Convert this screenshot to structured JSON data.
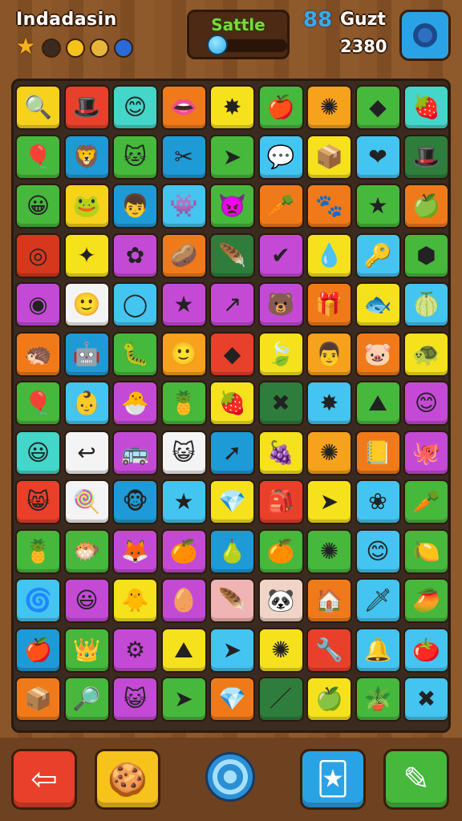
{
  "header": {
    "title": "Indadasin",
    "center_title": "Sattle",
    "player_name": "Guzt",
    "score": "2380",
    "progress": 0.0,
    "icons": [
      "star-icon",
      "lock-icon",
      "coin-icon",
      "coin-icon",
      "gem-icon"
    ],
    "player_icon": "88"
  },
  "colors": {
    "wood": "#7a4a22",
    "board": "#3a2a1f",
    "accent_green": "#7fd63a",
    "accent_blue": "#2aa3e6"
  },
  "board": {
    "rows": [
      [
        {
          "c": "#f6d21c",
          "g": "🔍",
          "n": "magnifier"
        },
        {
          "c": "#e8402a",
          "g": "🎩",
          "n": "hat"
        },
        {
          "c": "#44d6c8",
          "g": "😊",
          "n": "face"
        },
        {
          "c": "#f07a1a",
          "g": "👄",
          "n": "mouth"
        },
        {
          "c": "#f6e21c",
          "g": "✸",
          "n": "burst"
        },
        {
          "c": "#46b83c",
          "g": "🍎",
          "n": "apple"
        },
        {
          "c": "#f7a21c",
          "g": "✺",
          "n": "flower"
        },
        {
          "c": "#46b83c",
          "g": "◆",
          "n": "gem"
        },
        {
          "c": "#44d6c8",
          "g": "🍓",
          "n": "berry"
        }
      ],
      [
        {
          "c": "#46b83c",
          "g": "🎈",
          "n": "balloon"
        },
        {
          "c": "#1e9ad6",
          "g": "🦁",
          "n": "lion"
        },
        {
          "c": "#46b83c",
          "g": "🐱",
          "n": "cat"
        },
        {
          "c": "#1e9ad6",
          "g": "✂",
          "n": "scissors"
        },
        {
          "c": "#46b83c",
          "g": "➤",
          "n": "arrow"
        },
        {
          "c": "#44c4f0",
          "g": "💬",
          "n": "bubble"
        },
        {
          "c": "#f6e21c",
          "g": "📦",
          "n": "box"
        },
        {
          "c": "#44c4f0",
          "g": "❤",
          "n": "heart"
        },
        {
          "c": "#2e7d3c",
          "g": "🎩",
          "n": "hat"
        }
      ],
      [
        {
          "c": "#46b83c",
          "g": "😀",
          "n": "face"
        },
        {
          "c": "#f6d21c",
          "g": "🐸",
          "n": "frog"
        },
        {
          "c": "#1e9ad6",
          "g": "👦",
          "n": "boy"
        },
        {
          "c": "#44c4f0",
          "g": "👾",
          "n": "monster"
        },
        {
          "c": "#46b83c",
          "g": "👿",
          "n": "devil"
        },
        {
          "c": "#f07a1a",
          "g": "🥕",
          "n": "radish"
        },
        {
          "c": "#f07a1a",
          "g": "🐾",
          "n": "paw"
        },
        {
          "c": "#46b83c",
          "g": "★",
          "n": "star"
        },
        {
          "c": "#f07a1a",
          "g": "🍏",
          "n": "apple"
        }
      ],
      [
        {
          "c": "#d6381e",
          "g": "◎",
          "n": "ring"
        },
        {
          "c": "#f6e21c",
          "g": "✦",
          "n": "spark"
        },
        {
          "c": "#c44ad6",
          "g": "✿",
          "n": "blob"
        },
        {
          "c": "#f07a1a",
          "g": "🥔",
          "n": "potato"
        },
        {
          "c": "#2e7d3c",
          "g": "🪶",
          "n": "feather"
        },
        {
          "c": "#c44ad6",
          "g": "✔",
          "n": "check"
        },
        {
          "c": "#f6e21c",
          "g": "💧",
          "n": "drop"
        },
        {
          "c": "#44c4f0",
          "g": "🔑",
          "n": "key"
        },
        {
          "c": "#46b83c",
          "g": "⬢",
          "n": "hexagon"
        }
      ],
      [
        {
          "c": "#c44ad6",
          "g": "◉",
          "n": "donut"
        },
        {
          "c": "#f4f4f4",
          "g": "🙂",
          "n": "face"
        },
        {
          "c": "#44c4f0",
          "g": "◯",
          "n": "ring"
        },
        {
          "c": "#c44ad6",
          "g": "★",
          "n": "star"
        },
        {
          "c": "#c44ad6",
          "g": "↗",
          "n": "arrow"
        },
        {
          "c": "#c44ad6",
          "g": "🐻",
          "n": "bear"
        },
        {
          "c": "#f07a1a",
          "g": "🎁",
          "n": "gift"
        },
        {
          "c": "#f6e21c",
          "g": "🐟",
          "n": "fish"
        },
        {
          "c": "#44c4f0",
          "g": "🍈",
          "n": "melon"
        }
      ],
      [
        {
          "c": "#f07a1a",
          "g": "🦔",
          "n": "hedgehog"
        },
        {
          "c": "#1e9ad6",
          "g": "🤖",
          "n": "robot"
        },
        {
          "c": "#46b83c",
          "g": "🐛",
          "n": "bug"
        },
        {
          "c": "#f6a21c",
          "g": "🙂",
          "n": "face"
        },
        {
          "c": "#e8402a",
          "g": "◆",
          "n": "diamond"
        },
        {
          "c": "#f6e21c",
          "g": "🍃",
          "n": "leaf"
        },
        {
          "c": "#f6a21c",
          "g": "👨",
          "n": "man"
        },
        {
          "c": "#f07a1a",
          "g": "🐷",
          "n": "pig"
        },
        {
          "c": "#f6e21c",
          "g": "🐢",
          "n": "turtle"
        }
      ],
      [
        {
          "c": "#46b83c",
          "g": "🎈",
          "n": "balloon"
        },
        {
          "c": "#44c4f0",
          "g": "👶",
          "n": "baby"
        },
        {
          "c": "#c44ad6",
          "g": "🐣",
          "n": "chick"
        },
        {
          "c": "#46b83c",
          "g": "🍍",
          "n": "pineapple"
        },
        {
          "c": "#f6e21c",
          "g": "🍓",
          "n": "strawberry"
        },
        {
          "c": "#2e7d3c",
          "g": "✖",
          "n": "cross"
        },
        {
          "c": "#44c4f0",
          "g": "✸",
          "n": "burst"
        },
        {
          "c": "#46b83c",
          "g": "⛰",
          "n": "mountain"
        },
        {
          "c": "#c44ad6",
          "g": "😊",
          "n": "face"
        }
      ],
      [
        {
          "c": "#44d6c8",
          "g": "😃",
          "n": "face"
        },
        {
          "c": "#f4f4f4",
          "g": "↩",
          "n": "return"
        },
        {
          "c": "#c44ad6",
          "g": "🚌",
          "n": "bus"
        },
        {
          "c": "#f4f4f4",
          "g": "😺",
          "n": "cat"
        },
        {
          "c": "#1e9ad6",
          "g": "➚",
          "n": "arrow"
        },
        {
          "c": "#f6e21c",
          "g": "🍇",
          "n": "grape"
        },
        {
          "c": "#f6a21c",
          "g": "✺",
          "n": "splat"
        },
        {
          "c": "#f07a1a",
          "g": "📒",
          "n": "book"
        },
        {
          "c": "#c44ad6",
          "g": "🐙",
          "n": "octopus"
        }
      ],
      [
        {
          "c": "#e8402a",
          "g": "😸",
          "n": "cat"
        },
        {
          "c": "#f4f4f4",
          "g": "🍭",
          "n": "lollipop"
        },
        {
          "c": "#1e9ad6",
          "g": "🐵",
          "n": "monkey"
        },
        {
          "c": "#44c4f0",
          "g": "★",
          "n": "star"
        },
        {
          "c": "#f6e21c",
          "g": "💎",
          "n": "gem"
        },
        {
          "c": "#e8402a",
          "g": "🎒",
          "n": "bag"
        },
        {
          "c": "#f6e21c",
          "g": "➤",
          "n": "arrow"
        },
        {
          "c": "#44c4f0",
          "g": "❀",
          "n": "flower"
        },
        {
          "c": "#46b83c",
          "g": "🥕",
          "n": "carrot"
        }
      ],
      [
        {
          "c": "#46b83c",
          "g": "🍍",
          "n": "pineapple"
        },
        {
          "c": "#46b83c",
          "g": "🐡",
          "n": "fish"
        },
        {
          "c": "#c44ad6",
          "g": "🦊",
          "n": "fox"
        },
        {
          "c": "#c44ad6",
          "g": "🍊",
          "n": "orange"
        },
        {
          "c": "#1e9ad6",
          "g": "🍐",
          "n": "pear"
        },
        {
          "c": "#46b83c",
          "g": "🍊",
          "n": "orange"
        },
        {
          "c": "#46b83c",
          "g": "✺",
          "n": "splat"
        },
        {
          "c": "#44c4f0",
          "g": "😊",
          "n": "face"
        },
        {
          "c": "#46b83c",
          "g": "🍋",
          "n": "lemon"
        }
      ],
      [
        {
          "c": "#44c4f0",
          "g": "🌀",
          "n": "swirl"
        },
        {
          "c": "#c44ad6",
          "g": "😃",
          "n": "face"
        },
        {
          "c": "#f6e21c",
          "g": "🐥",
          "n": "chick"
        },
        {
          "c": "#c44ad6",
          "g": "🥚",
          "n": "egg"
        },
        {
          "c": "#f0b4b4",
          "g": "🪶",
          "n": "feather"
        },
        {
          "c": "#f0d4c8",
          "g": "🐼",
          "n": "panda"
        },
        {
          "c": "#f07a1a",
          "g": "🏠",
          "n": "house"
        },
        {
          "c": "#44c4f0",
          "g": "🗡",
          "n": "sword"
        },
        {
          "c": "#46b83c",
          "g": "🥭",
          "n": "mango"
        }
      ],
      [
        {
          "c": "#1e9ad6",
          "g": "🍎",
          "n": "apple"
        },
        {
          "c": "#46b83c",
          "g": "👑",
          "n": "crown"
        },
        {
          "c": "#c44ad6",
          "g": "⚙",
          "n": "gear"
        },
        {
          "c": "#f6e21c",
          "g": "⛰",
          "n": "mountain"
        },
        {
          "c": "#44c4f0",
          "g": "➤",
          "n": "arrow"
        },
        {
          "c": "#f6e21c",
          "g": "✺",
          "n": "flower"
        },
        {
          "c": "#e8402a",
          "g": "🔧",
          "n": "wrench"
        },
        {
          "c": "#44c4f0",
          "g": "🔔",
          "n": "bell"
        },
        {
          "c": "#44c4f0",
          "g": "🍅",
          "n": "tomato"
        }
      ],
      [
        {
          "c": "#f07a1a",
          "g": "📦",
          "n": "box"
        },
        {
          "c": "#46b83c",
          "g": "🔎",
          "n": "magnifier"
        },
        {
          "c": "#c44ad6",
          "g": "😺",
          "n": "cat"
        },
        {
          "c": "#46b83c",
          "g": "➤",
          "n": "arrow"
        },
        {
          "c": "#f07a1a",
          "g": "💎",
          "n": "gem"
        },
        {
          "c": "#2e7d3c",
          "g": "／",
          "n": "stick"
        },
        {
          "c": "#f6e21c",
          "g": "🍏",
          "n": "apple"
        },
        {
          "c": "#46b83c",
          "g": "🪴",
          "n": "plant"
        },
        {
          "c": "#44c4f0",
          "g": "✖",
          "n": "cross"
        }
      ]
    ]
  },
  "footer": {
    "back_icon": "⇦",
    "cookie_icon": "🍪",
    "swirl_icon": "swirl-icon",
    "card_icon": "🃏",
    "eraser_icon": "✎"
  }
}
